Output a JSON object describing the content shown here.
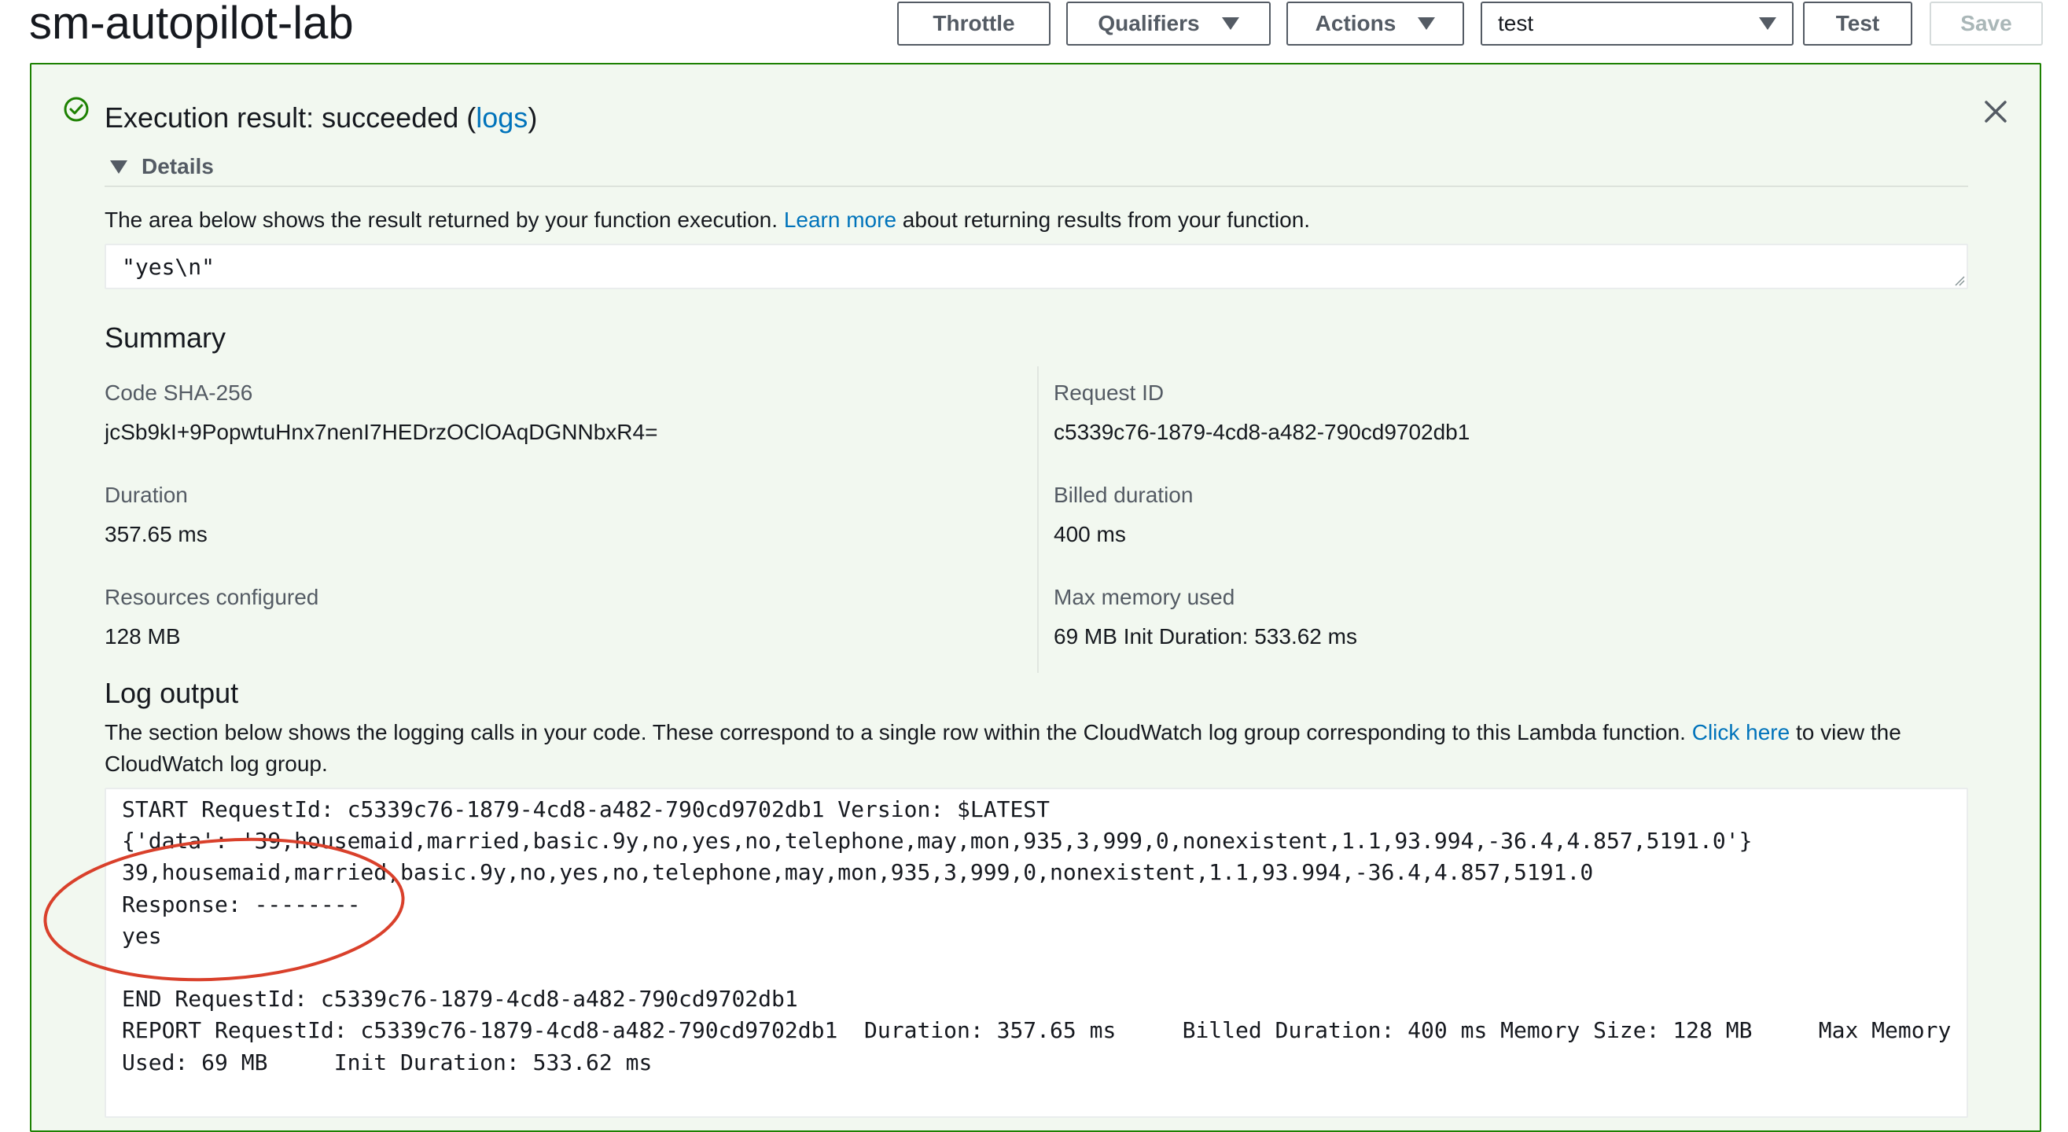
{
  "header": {
    "title": "sm-autopilot-lab",
    "throttle_label": "Throttle",
    "qualifiers_label": "Qualifiers",
    "actions_label": "Actions",
    "test_event_value": "test",
    "test_label": "Test",
    "save_label": "Save"
  },
  "result": {
    "title_prefix": "Execution result: succeeded (",
    "logs_link": "logs",
    "title_suffix": ")",
    "details_label": "Details",
    "desc_prefix": "The area below shows the result returned by your function execution. ",
    "learn_more": "Learn more",
    "desc_suffix": " about returning results from your function.",
    "returned_value": "\"yes\\n\""
  },
  "summary": {
    "heading": "Summary",
    "code_sha_label": "Code SHA-256",
    "code_sha_value": "jcSb9kI+9PopwtuHnx7nenI7HEDrzOClOAqDGNNbxR4=",
    "request_id_label": "Request ID",
    "request_id_value": "c5339c76-1879-4cd8-a482-790cd9702db1",
    "duration_label": "Duration",
    "duration_value": "357.65 ms",
    "billed_label": "Billed duration",
    "billed_value": "400 ms",
    "resources_label": "Resources configured",
    "resources_value": "128 MB",
    "max_memory_label": "Max memory used",
    "max_memory_value": "69 MB Init Duration: 533.62 ms"
  },
  "log_output": {
    "heading": "Log output",
    "desc_prefix": "The section below shows the logging calls in your code. These correspond to a single row within the CloudWatch log group corresponding to this Lambda function. ",
    "click_here": "Click here",
    "desc_suffix": " to view the CloudWatch log group.",
    "lines": [
      "START RequestId: c5339c76-1879-4cd8-a482-790cd9702db1 Version: $LATEST",
      "{'data': '39,housemaid,married,basic.9y,no,yes,no,telephone,may,mon,935,3,999,0,nonexistent,1.1,93.994,-36.4,4.857,5191.0'}",
      "39,housemaid,married,basic.9y,no,yes,no,telephone,may,mon,935,3,999,0,nonexistent,1.1,93.994,-36.4,4.857,5191.0",
      "Response: --------",
      "yes",
      "",
      "END RequestId: c5339c76-1879-4cd8-a482-790cd9702db1",
      "REPORT RequestId: c5339c76-1879-4cd8-a482-790cd9702db1  Duration: 357.65 ms     Billed Duration: 400 ms Memory Size: 128 MB     Max Memory",
      "Used: 69 MB     Init Duration: 533.62 ms"
    ]
  },
  "colors": {
    "success_green": "#1d8102",
    "panel_bg": "#f2f8f0",
    "link_blue": "#0073bb",
    "annotation_red": "#d9402b"
  },
  "icons": [
    "check-circle-icon",
    "close-icon",
    "caret-down-icon",
    "resize-grip-icon"
  ]
}
